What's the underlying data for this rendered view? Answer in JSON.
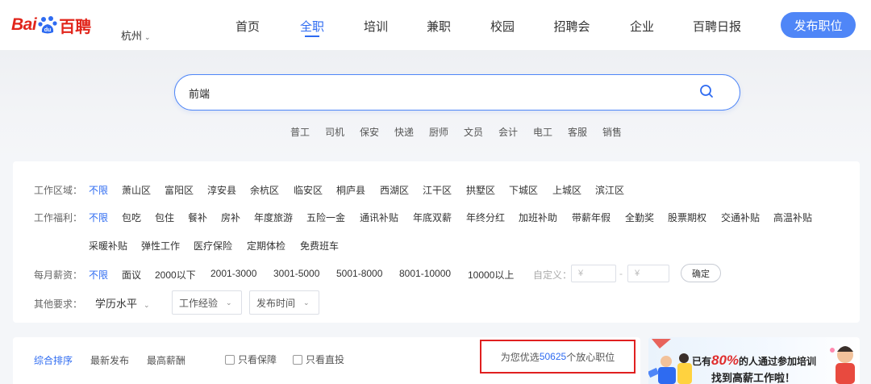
{
  "header": {
    "logo": {
      "bai": "Bai",
      "du": "du",
      "text": "百聘"
    },
    "city": "杭州",
    "nav": [
      "首页",
      "全职",
      "培训",
      "兼职",
      "校园",
      "招聘会",
      "企业",
      "百聘日报"
    ],
    "active_nav": "全职",
    "publish_label": "发布职位"
  },
  "search": {
    "value": "前端",
    "icon": "search-icon",
    "hot_tags": [
      "普工",
      "司机",
      "保安",
      "快递",
      "厨师",
      "文员",
      "会计",
      "电工",
      "客服",
      "销售"
    ]
  },
  "filters": {
    "area_label": "工作区域：",
    "area_options": [
      "不限",
      "萧山区",
      "富阳区",
      "淳安县",
      "余杭区",
      "临安区",
      "桐庐县",
      "西湖区",
      "江干区",
      "拱墅区",
      "下城区",
      "上城区",
      "滨江区"
    ],
    "welfare_label": "工作福利：",
    "welfare_options_row1": [
      "不限",
      "包吃",
      "包住",
      "餐补",
      "房补",
      "年度旅游",
      "五险一金",
      "通讯补贴",
      "年底双薪",
      "年终分红",
      "加班补助",
      "带薪年假",
      "全勤奖",
      "股票期权",
      "交通补贴",
      "高温补贴"
    ],
    "welfare_options_row2": [
      "采暖补贴",
      "弹性工作",
      "医疗保险",
      "定期体检",
      "免费班车"
    ],
    "salary_label": "每月薪资：",
    "salary_options": [
      "不限",
      "面议",
      "2000以下",
      "2001-3000",
      "3001-5000",
      "5001-8000",
      "8001-10000",
      "10000以上"
    ],
    "custom_label": "自定义：",
    "custom_placeholder": "¥",
    "dash": "-",
    "confirm_label": "确定",
    "other_label": "其他要求：",
    "education": "学历水平",
    "experience": "工作经验",
    "publish_time": "发布时间"
  },
  "sort": {
    "options": [
      "综合排序",
      "最新发布",
      "最高薪酬"
    ],
    "active": "综合排序",
    "checks": [
      "只看保障",
      "只看直投"
    ],
    "count_prefix": "为您优选",
    "count": "50625",
    "count_suffix": "个放心职位"
  },
  "ad": {
    "line1_prefix": "已有",
    "pct": "80%",
    "line1_suffix": "的人通过参加培训",
    "line2": "找到高薪工作啦！"
  },
  "colors": {
    "brand_red": "#e1251b",
    "accent_blue": "#2e6bf1",
    "highlight_red": "#e02020"
  }
}
